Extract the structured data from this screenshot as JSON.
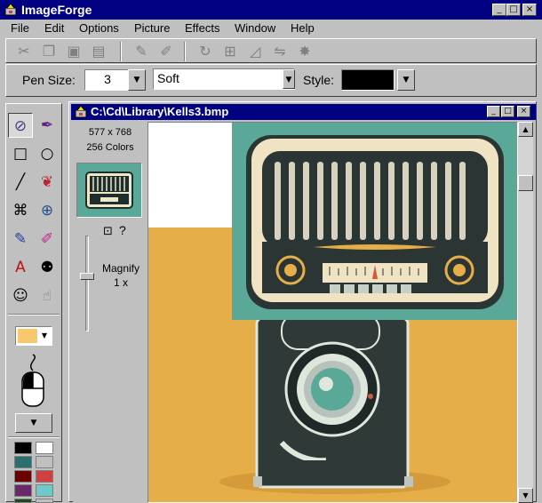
{
  "app": {
    "title": "ImageForge",
    "window_buttons": {
      "minimize": "_",
      "maximize": "□",
      "close": "×"
    }
  },
  "menu": [
    "File",
    "Edit",
    "Options",
    "Picture",
    "Effects",
    "Window",
    "Help"
  ],
  "toolbar": {
    "icons": [
      "cut-icon",
      "copy-icon",
      "paste-icon",
      "paste-new-icon",
      "pen-icon",
      "brush-icon",
      "rotate-icon",
      "resize-icon",
      "skew-icon",
      "flip-icon",
      "sharpen-icon"
    ]
  },
  "penbar": {
    "pen_size_label": "Pen Size:",
    "pen_size_value": "3",
    "style_value": "Soft",
    "style_label": "Style:",
    "style_swatch_color": "#000000"
  },
  "palette": {
    "tools": [
      "eyedropper-icon",
      "pipette-icon",
      "rectangle-icon",
      "ellipse-icon",
      "line-icon",
      "spray-icon",
      "clone-icon",
      "zoom-icon",
      "brush-icon",
      "eraser-icon",
      "text-icon",
      "people-icon",
      "face-icon",
      "hand-icon"
    ],
    "primary_color": "#f8c870",
    "colors": [
      "#000000",
      "#ffffff",
      "#2d6e6e",
      "#c0c0c0",
      "#6a0000",
      "#d04040",
      "#6a2a6a",
      "#70c8c8",
      "#1a4a1a",
      "#c0c0c0"
    ]
  },
  "document": {
    "title": "C:\\Cd\\Library\\Kells3.bmp",
    "dimensions": "577 x 768",
    "colors": "256 Colors",
    "magnify_label": "Magnify",
    "magnify_value": "1  x",
    "help_glyph": "?"
  }
}
